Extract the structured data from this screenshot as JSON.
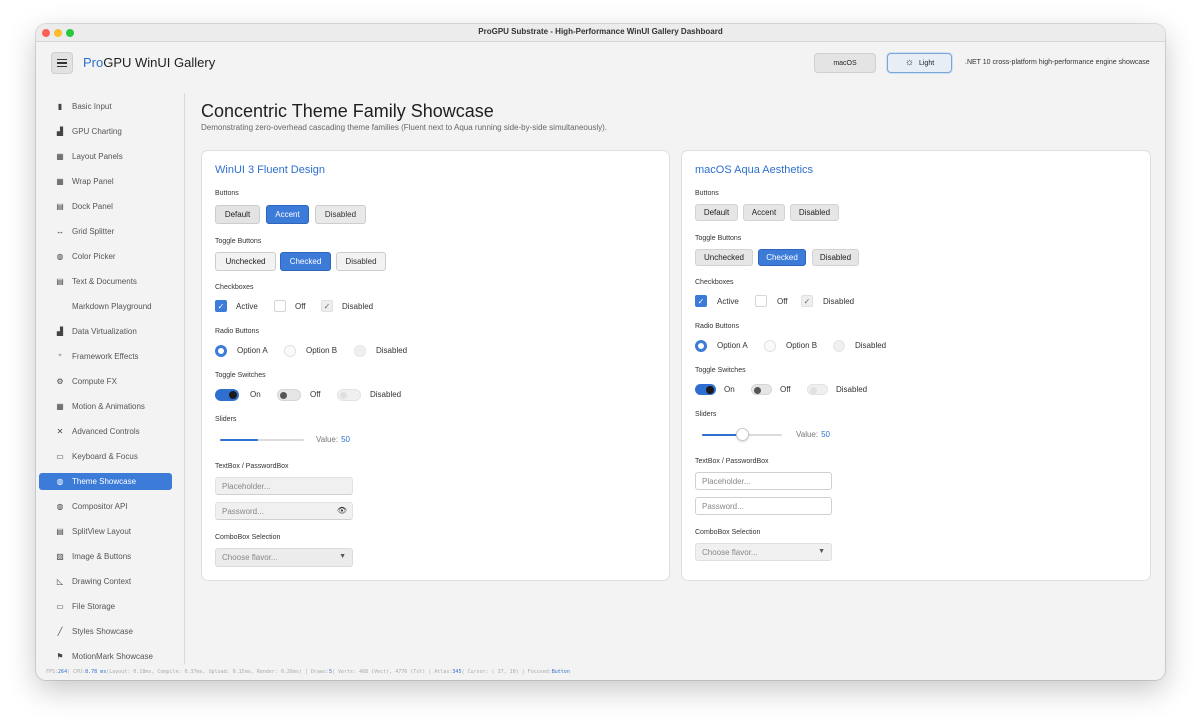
{
  "window": {
    "title": "ProGPU Substrate - High-Performance WinUI Gallery Dashboard"
  },
  "header": {
    "title_prefix": "Pro",
    "title_rest": "GPU WinUI Gallery",
    "macos_button": "macOS",
    "light_button": "Light",
    "subtitle": ".NET 10 cross-platform high-performance engine showcase"
  },
  "sidebar": {
    "items": [
      {
        "label": "Basic Input",
        "icon": "▮"
      },
      {
        "label": "GPU Charting",
        "icon": "▟"
      },
      {
        "label": "Layout Panels",
        "icon": "▦"
      },
      {
        "label": "Wrap Panel",
        "icon": "▦"
      },
      {
        "label": "Dock Panel",
        "icon": "▤"
      },
      {
        "label": "Grid Splitter",
        "icon": "↔"
      },
      {
        "label": "Color Picker",
        "icon": "◍"
      },
      {
        "label": "Text & Documents",
        "icon": "▤"
      },
      {
        "label": "Markdown Playground",
        "icon": ""
      },
      {
        "label": "Data Virtualization",
        "icon": "▟"
      },
      {
        "label": "Framework Effects",
        "icon": "⁺"
      },
      {
        "label": "Compute FX",
        "icon": "⚙"
      },
      {
        "label": "Motion & Animations",
        "icon": "▦"
      },
      {
        "label": "Advanced Controls",
        "icon": "✕"
      },
      {
        "label": "Keyboard & Focus",
        "icon": "▭"
      },
      {
        "label": "Theme Showcase",
        "icon": "◍"
      },
      {
        "label": "Compositor API",
        "icon": "◍"
      },
      {
        "label": "SplitView Layout",
        "icon": "▤"
      },
      {
        "label": "Image & Buttons",
        "icon": "▨"
      },
      {
        "label": "Drawing Context",
        "icon": "◺"
      },
      {
        "label": "File Storage",
        "icon": "▭"
      },
      {
        "label": "Styles Showcase",
        "icon": "╱"
      },
      {
        "label": "MotionMark Showcase",
        "icon": "⚑"
      }
    ]
  },
  "page": {
    "title": "Concentric Theme Family Showcase",
    "subtitle": "Demonstrating zero-overhead cascading theme families (Fluent next to Aqua running side-by-side simultaneously)."
  },
  "fluent": {
    "title": "WinUI 3 Fluent Design",
    "buttons_label": "Buttons",
    "buttons": [
      "Default",
      "Accent",
      "Disabled"
    ],
    "toggle_label": "Toggle Buttons",
    "toggles": [
      "Unchecked",
      "Checked",
      "Disabled"
    ],
    "checkbox_label": "Checkboxes",
    "checkboxes": [
      "Active",
      "Off",
      "Disabled"
    ],
    "radio_label": "Radio Buttons",
    "radios": [
      "Option A",
      "Option B",
      "Disabled"
    ],
    "switch_label": "Toggle Switches",
    "switches": [
      "On",
      "Off",
      "Disabled"
    ],
    "slider_label": "Sliders",
    "slider_value_label": "Value:",
    "slider_value": "50",
    "textbox_label": "TextBox / PasswordBox",
    "textbox_placeholder": "Placeholder...",
    "password_placeholder": "Password...",
    "combo_label": "ComboBox Selection",
    "combo_placeholder": "Choose flavor..."
  },
  "aqua": {
    "title": "macOS Aqua Aesthetics",
    "buttons_label": "Buttons",
    "buttons": [
      "Default",
      "Accent",
      "Disabled"
    ],
    "toggle_label": "Toggle Buttons",
    "toggles": [
      "Unchecked",
      "Checked",
      "Disabled"
    ],
    "checkbox_label": "Checkboxes",
    "checkboxes": [
      "Active",
      "Off",
      "Disabled"
    ],
    "radio_label": "Radio Buttons",
    "radios": [
      "Option A",
      "Option B",
      "Disabled"
    ],
    "switch_label": "Toggle Switches",
    "switches": [
      "On",
      "Off",
      "Disabled"
    ],
    "slider_label": "Sliders",
    "slider_value_label": "Value:",
    "slider_value": "50",
    "textbox_label": "TextBox / PasswordBox",
    "textbox_placeholder": "Placeholder...",
    "password_placeholder": "Password...",
    "combo_label": "ComboBox Selection",
    "combo_placeholder": "Choose flavor..."
  },
  "status": {
    "part1": "FPS: ",
    "fps": "264",
    "part2": " | CPU: ",
    "cpu": "8.78 ms",
    "part3": " (Layout: 0.18ms, Compile: 0.37ms, Upload: 0.15ms, Render: 0.26ms) | Draws: ",
    "draws": "5",
    "part4": " | Verts: 468 (Vect), 4776 (Txt) | Atlas: ",
    "atlas": "345",
    "part5": " | Cursor: ( 37, 10) | Focused: ",
    "focused": "Button"
  },
  "colors": {
    "accent": "#3d7bd9",
    "brand": "#2f6fcf"
  }
}
